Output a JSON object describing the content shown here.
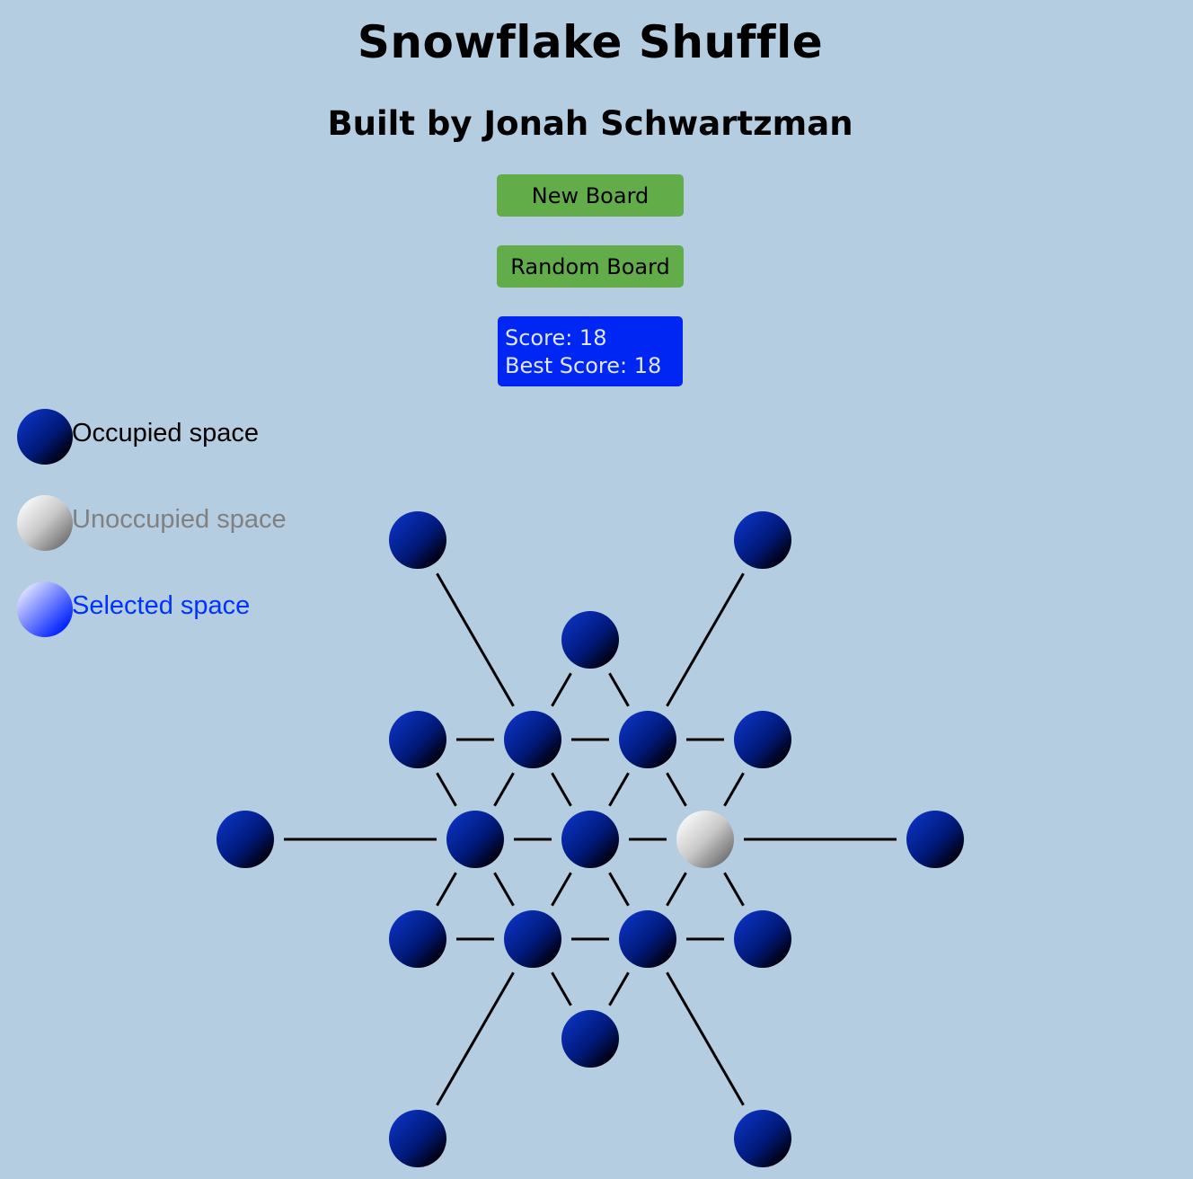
{
  "header": {
    "title": "Snowflake Shuffle",
    "subtitle": "Built by Jonah Schwartzman"
  },
  "controls": {
    "new_board_label": "New Board",
    "random_board_label": "Random Board"
  },
  "score": {
    "score_text": "Score: 18",
    "best_score_text": "Best Score: 18"
  },
  "legend": {
    "occupied_label": "Occupied space",
    "unoccupied_label": "Unoccupied space",
    "selected_label": "Selected space"
  },
  "colors": {
    "background": "#b5cde1",
    "button": "#62ad4a",
    "score_box": "#0026f4",
    "occupied_ball": "#001a8c",
    "unoccupied_ball": "#c8c8c8",
    "selected_ball": "#0033ff"
  },
  "board": {
    "spaces": [
      {
        "id": "outer-top-left",
        "state": "occupied"
      },
      {
        "id": "outer-top-right",
        "state": "occupied"
      },
      {
        "id": "top",
        "state": "occupied"
      },
      {
        "id": "row1-a",
        "state": "occupied"
      },
      {
        "id": "row1-b",
        "state": "occupied"
      },
      {
        "id": "row1-c",
        "state": "occupied"
      },
      {
        "id": "row1-d",
        "state": "occupied"
      },
      {
        "id": "outer-left",
        "state": "occupied"
      },
      {
        "id": "row2-a",
        "state": "occupied"
      },
      {
        "id": "row2-b",
        "state": "occupied"
      },
      {
        "id": "row2-c",
        "state": "unoccupied"
      },
      {
        "id": "outer-right",
        "state": "occupied"
      },
      {
        "id": "row3-a",
        "state": "occupied"
      },
      {
        "id": "row3-b",
        "state": "occupied"
      },
      {
        "id": "row3-c",
        "state": "occupied"
      },
      {
        "id": "row3-d",
        "state": "occupied"
      },
      {
        "id": "bottom",
        "state": "occupied"
      },
      {
        "id": "outer-bottom-left",
        "state": "occupied"
      },
      {
        "id": "outer-bottom-right",
        "state": "occupied"
      }
    ]
  }
}
